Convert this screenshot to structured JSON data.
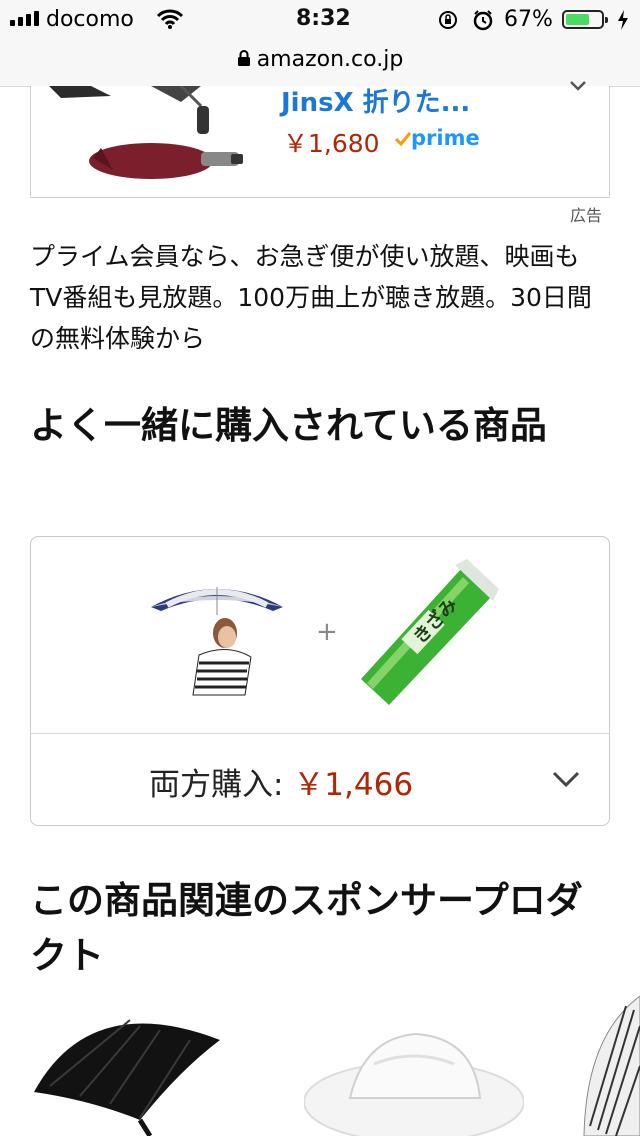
{
  "status_bar": {
    "carrier": "docomo",
    "time": "8:32",
    "battery_percent": "67%",
    "battery_level": 0.67
  },
  "url_bar": {
    "domain": "amazon.co.jp"
  },
  "ad": {
    "title": "JinsX 折りた...",
    "price": "￥1,680",
    "prime_badge": "prime",
    "label": "広告"
  },
  "prime_promo": {
    "text": "プライム会員なら、お急ぎ便が使い放題、映画もTV番組も見放題。100万曲上が聴き放題。30日間の無料体験から"
  },
  "frequently_bought": {
    "title": "よく一緒に購入されている商品",
    "plus": "+",
    "both_buy_label": "両方購入: ",
    "both_buy_price": "￥1,466"
  },
  "sponsored": {
    "title": "この商品関連のスポンサープロダクト"
  },
  "colors": {
    "price": "#b12704",
    "link": "#1a78d6",
    "prime": "#1a98ff"
  },
  "icons": [
    "signal-icon",
    "wifi-icon",
    "rotation-lock-icon",
    "alarm-icon",
    "battery-icon",
    "charging-icon",
    "lock-icon",
    "chevron-down-icon"
  ]
}
